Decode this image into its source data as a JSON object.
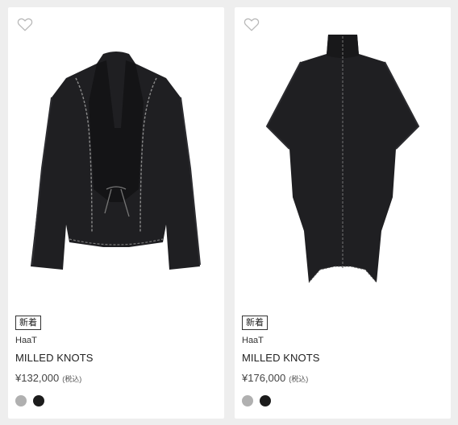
{
  "products": [
    {
      "badge": "新着",
      "brand": "HaaT",
      "name": "MILLED KNOTS",
      "price": "¥132,000",
      "tax_label": "(税込)",
      "colors": [
        "#b0b0b0",
        "#1c1c1c"
      ]
    },
    {
      "badge": "新着",
      "brand": "HaaT",
      "name": "MILLED KNOTS",
      "price": "¥176,000",
      "tax_label": "(税込)",
      "colors": [
        "#b0b0b0",
        "#1c1c1c"
      ]
    }
  ],
  "icons": {
    "favorite": "heart-outline-icon"
  }
}
